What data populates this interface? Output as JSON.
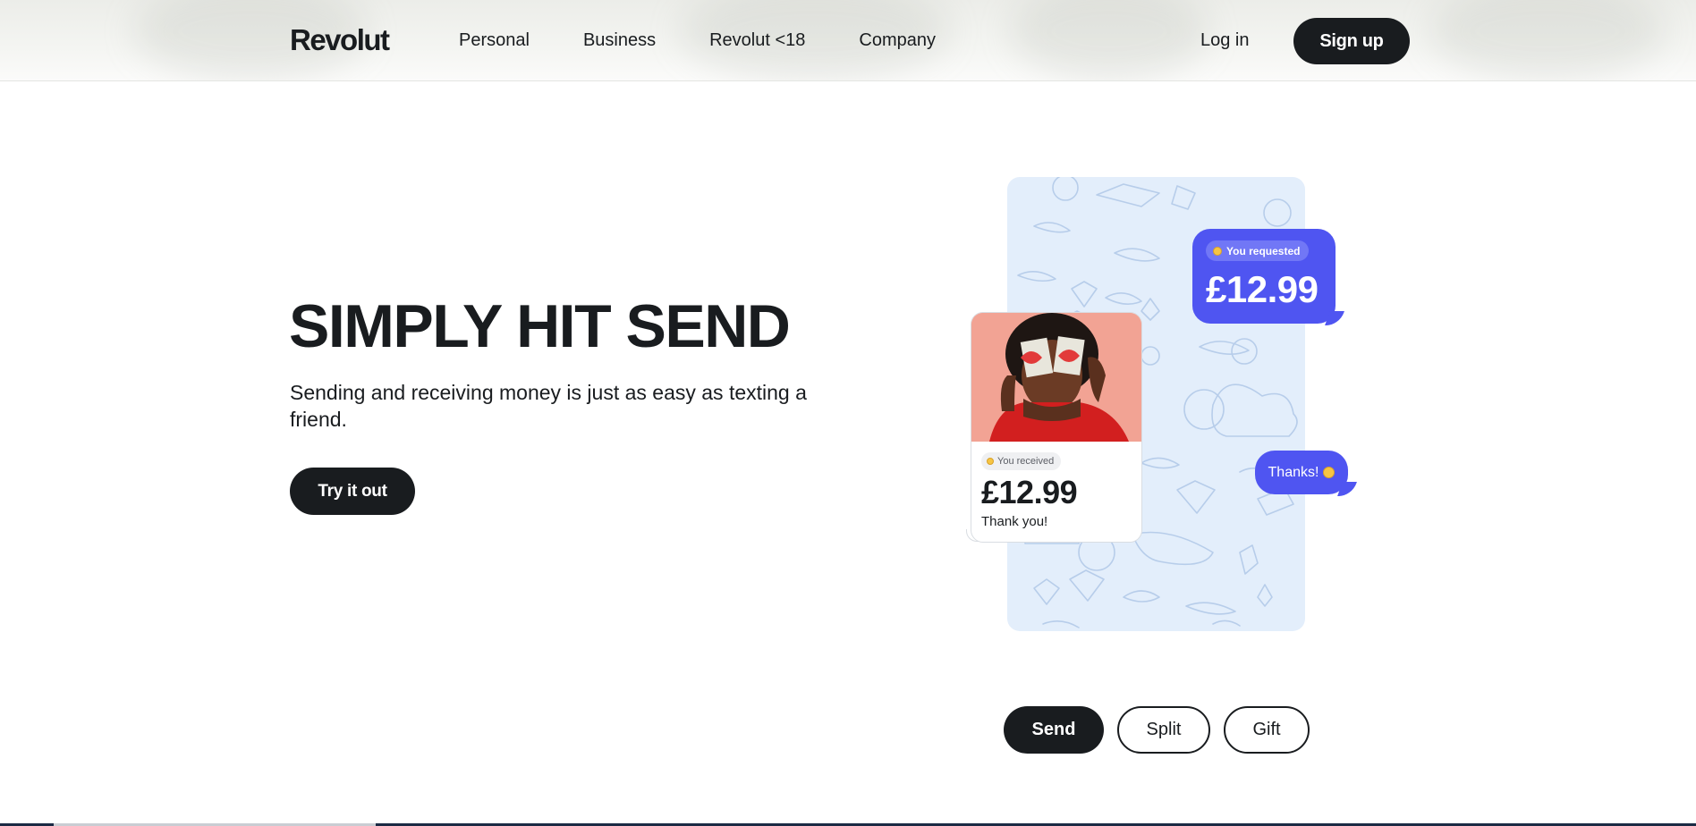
{
  "header": {
    "logo": "Revolut",
    "nav": [
      "Personal",
      "Business",
      "Revolut <18",
      "Company"
    ],
    "login_label": "Log in",
    "signup_label": "Sign up"
  },
  "hero": {
    "title": "SIMPLY HIT SEND",
    "subtitle": "Sending and receiving money is just as easy as texting a friend.",
    "cta_label": "Try it out"
  },
  "illustration": {
    "request_pill": "You requested",
    "request_amount": "£12.99",
    "received_pill": "You received",
    "received_amount": "£12.99",
    "received_note": "Thank you!",
    "thanks_bubble": "Thanks!"
  },
  "tabs": [
    "Send",
    "Split",
    "Gift"
  ],
  "active_tab": "Send",
  "colors": {
    "accent": "#4f55f1",
    "dark": "#191c1f",
    "phone_bg": "#e3eefb"
  }
}
